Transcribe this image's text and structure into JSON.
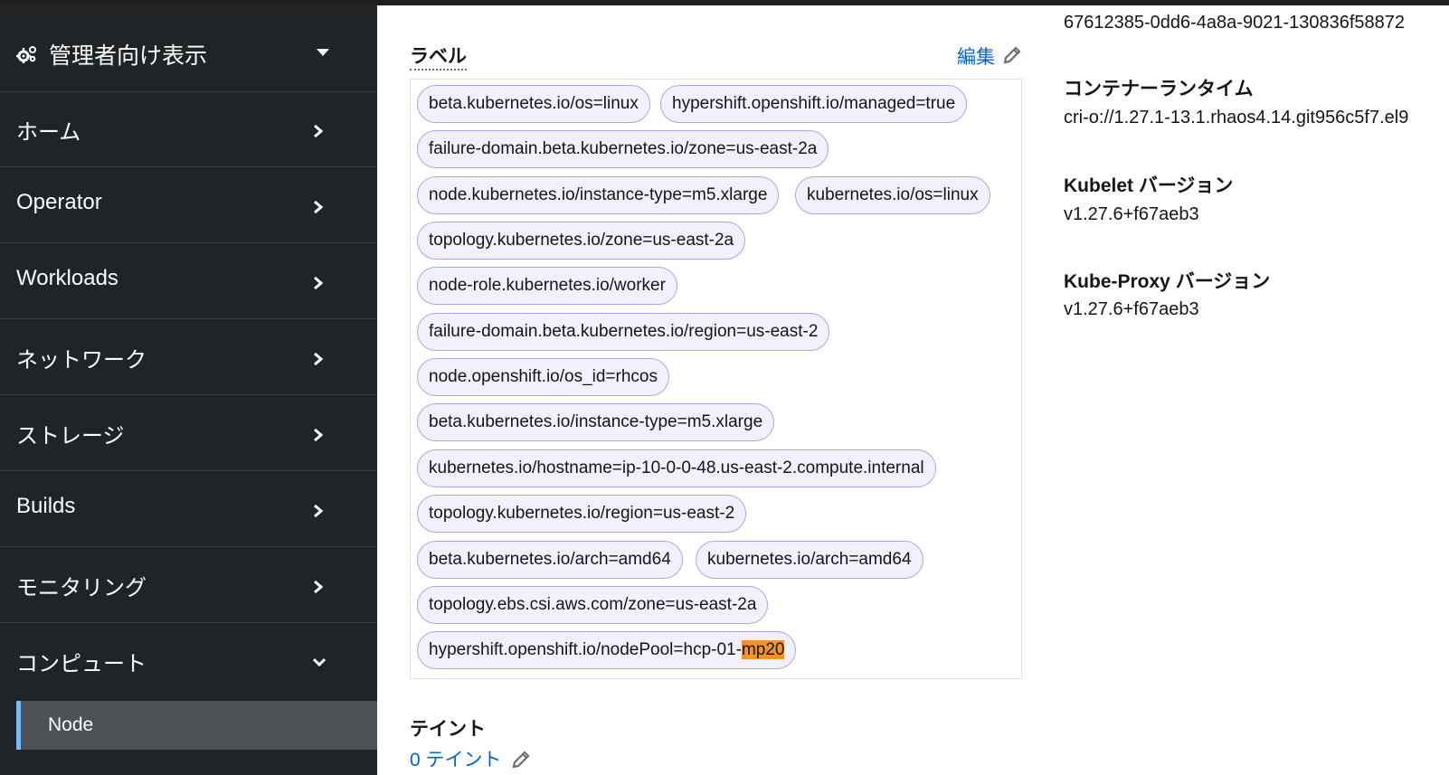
{
  "sidebar": {
    "perspective_label": "管理者向け表示",
    "items": [
      {
        "label": "ホーム"
      },
      {
        "label": "Operator"
      },
      {
        "label": "Workloads"
      },
      {
        "label": "ネットワーク"
      },
      {
        "label": "ストレージ"
      },
      {
        "label": "Builds"
      },
      {
        "label": "モニタリング"
      },
      {
        "label": "コンピュート"
      }
    ],
    "active_subitem": "Node"
  },
  "labels_section": {
    "title": "ラベル",
    "edit_label": "編集",
    "chips": [
      "beta.kubernetes.io/os=linux",
      "hypershift.openshift.io/managed=true",
      "failure-domain.beta.kubernetes.io/zone=us-east-2a",
      "node.kubernetes.io/instance-type=m5.xlarge",
      "kubernetes.io/os=linux",
      "topology.kubernetes.io/zone=us-east-2a",
      "node-role.kubernetes.io/worker",
      "failure-domain.beta.kubernetes.io/region=us-east-2",
      "node.openshift.io/os_id=rhcos",
      "beta.kubernetes.io/instance-type=m5.xlarge",
      "kubernetes.io/hostname=ip-10-0-0-48.us-east-2.compute.internal",
      "topology.kubernetes.io/region=us-east-2",
      "beta.kubernetes.io/arch=amd64",
      "kubernetes.io/arch=amd64",
      "topology.ebs.csi.aws.com/zone=us-east-2a"
    ],
    "last_chip_prefix": "hypershift.openshift.io/nodePool=hcp-01-",
    "last_chip_highlight": "mp20"
  },
  "taints_section": {
    "title": "テイント",
    "link_label": "0 テイント"
  },
  "details": {
    "uid_value": "67612385-0dd6-4a8a-9021-130836f58872",
    "container_runtime_title": "コンテナーランタイム",
    "container_runtime_value": "cri-o://1.27.1-13.1.rhaos4.14.git956c5f7.el9",
    "kubelet_title": "Kubelet バージョン",
    "kubelet_value": "v1.27.6+f67aeb3",
    "kubeproxy_title": "Kube-Proxy バージョン",
    "kubeproxy_value": "v1.27.6+f67aeb3"
  },
  "colors": {
    "sidebar_bg": "#212427",
    "link": "#0066cc",
    "chip_border": "#b2a3e8",
    "highlight": "#f0932a",
    "active_indicator": "#73bcf7"
  },
  "icons": [
    "gears-icon",
    "caret-down-icon",
    "chevron-right-icon",
    "chevron-down-icon",
    "pencil-icon"
  ]
}
